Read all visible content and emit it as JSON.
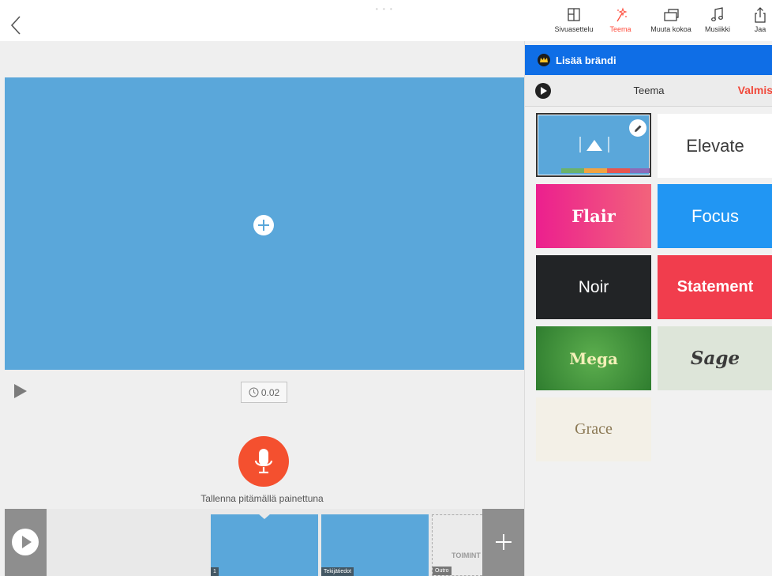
{
  "toolbar": {
    "tools": [
      {
        "label": "Sivuasettelu",
        "icon": "layout-icon"
      },
      {
        "label": "Teema",
        "icon": "magic-wand-icon",
        "active": true
      },
      {
        "label": "Muuta kokoa",
        "icon": "resize-icon"
      },
      {
        "label": "Musiikki",
        "icon": "music-note-icon"
      },
      {
        "label": "Jaa",
        "icon": "share-icon"
      }
    ]
  },
  "editor": {
    "duration": "0.02",
    "record_hint": "Tallenna pitämällä painettuna"
  },
  "timeline": {
    "slides": [
      {
        "tag": "1"
      },
      {
        "tag": "Tekijätiedot"
      },
      {
        "tag": "Outro",
        "brand_text": "TOIMINT"
      }
    ]
  },
  "theme_panel": {
    "brand_label": "Lisää brändi",
    "title": "Teema",
    "done_label": "Valmis",
    "themes": [
      {
        "name": "Elevate"
      },
      {
        "name": "Flair"
      },
      {
        "name": "Focus"
      },
      {
        "name": "Noir"
      },
      {
        "name": "Statement"
      },
      {
        "name": "Mega"
      },
      {
        "name": "Sage"
      },
      {
        "name": "Grace"
      }
    ],
    "default_stripe_colors": [
      "#6bb26b",
      "#f2a341",
      "#e8554e",
      "#8c6bb8"
    ]
  },
  "colors": {
    "accent": "#ff4b3b",
    "brand_bar": "#0f6ee6",
    "canvas": "#5aa7da",
    "record": "#f4502f"
  }
}
